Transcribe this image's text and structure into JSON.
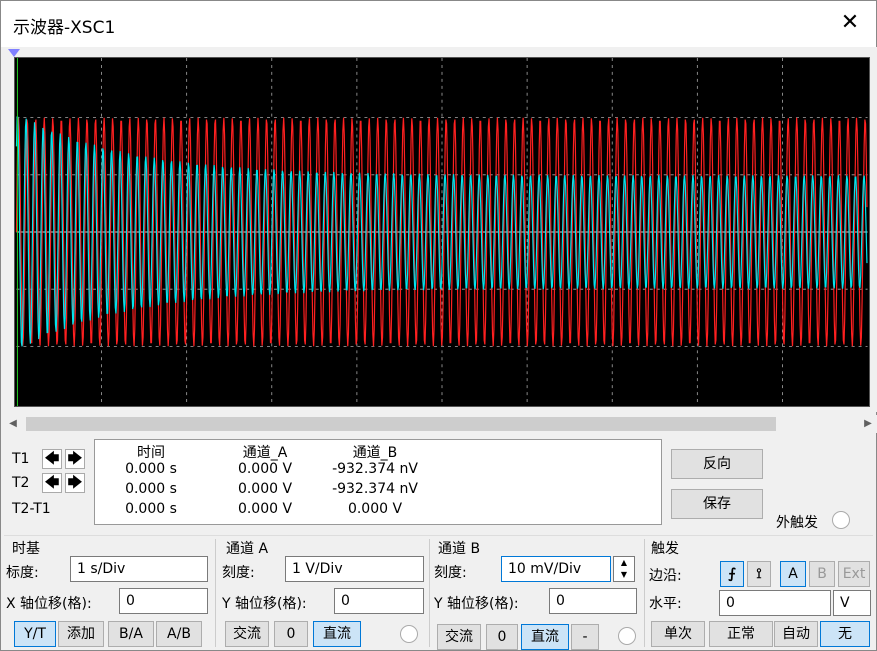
{
  "window": {
    "title": "示波器-XSC1"
  },
  "scope": {
    "channel_a_color": "#00e5ee",
    "channel_b_color": "#ff2020",
    "background": "#000000",
    "grid": true
  },
  "cursors": {
    "t1_label": "T1",
    "t2_label": "T2",
    "t2t1_label": "T2-T1",
    "left_arrow": "🡄",
    "right_arrow": "🡆"
  },
  "readout": {
    "headers": [
      "时间",
      "通道_A",
      "通道_B"
    ],
    "rows": [
      [
        "0.000 s",
        "0.000 V",
        "-932.374 nV"
      ],
      [
        "0.000 s",
        "0.000 V",
        "-932.374 nV"
      ],
      [
        "0.000 s",
        "0.000 V",
        "0.000 V"
      ]
    ]
  },
  "actions": {
    "reverse": "反向",
    "save": "保存",
    "ext_trigger": "外触发"
  },
  "timebase": {
    "title": "时基",
    "scale_label": "标度:",
    "scale_value": "1  s/Div",
    "xpos_label": "X 轴位移(格):",
    "xpos_value": "0",
    "modes": [
      "Y/T",
      "添加",
      "B/A",
      "A/B"
    ]
  },
  "channel_a": {
    "title": "通道 A",
    "scale_label": "刻度:",
    "scale_value": "1  V/Div",
    "ypos_label": "Y 轴位移(格):",
    "ypos_value": "0",
    "coupling": [
      "交流",
      "0",
      "直流"
    ]
  },
  "channel_b": {
    "title": "通道 B",
    "scale_label": "刻度:",
    "scale_value": "10 mV/Div",
    "ypos_label": "Y 轴位移(格):",
    "ypos_value": "0",
    "coupling": [
      "交流",
      "0",
      "直流",
      "-"
    ]
  },
  "trigger": {
    "title": "触发",
    "edge_label": "边沿:",
    "level_label": "水平:",
    "level_value": "0",
    "level_unit": "V",
    "sources": [
      "A",
      "B",
      "Ext"
    ],
    "modes": [
      "单次",
      "正常",
      "自动",
      "无"
    ]
  }
}
